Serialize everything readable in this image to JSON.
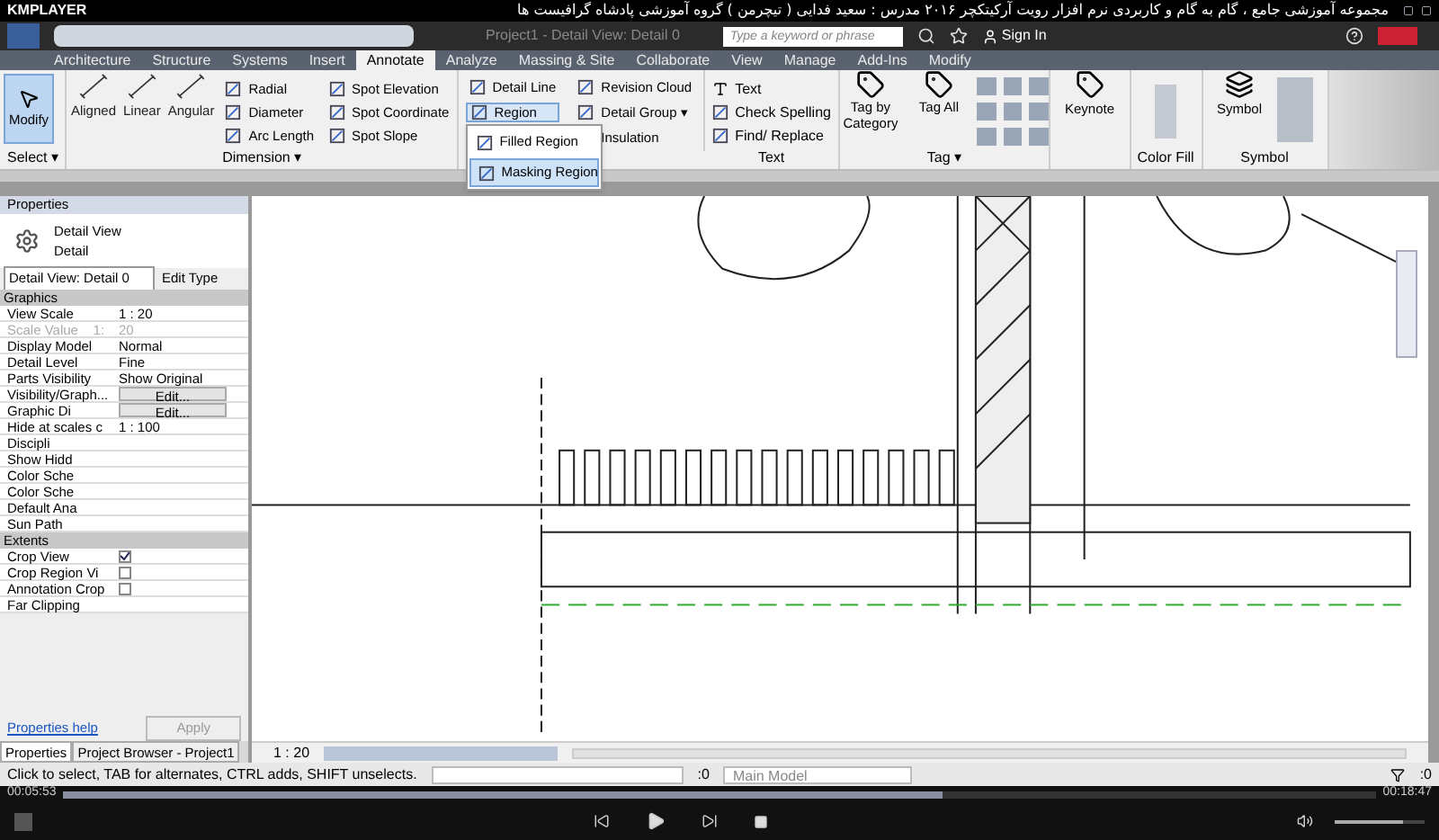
{
  "player": {
    "brand": "KMPLAYER",
    "title": "مجموعه آموزشی جامع ، گام به گام و کاربردی نرم افزار رویت آرکیتکچر ۲۰۱۶ مدرس : سعید فدایی ( تیچرمن ) گروه آموزشی پادشاه گرافیست ها",
    "elapsed": "00:05:53",
    "total": "00:18:47",
    "seek": {
      "level": 0.67
    },
    "volume": {
      "level": 0.75
    }
  },
  "app": {
    "title": "Project1 - Detail View: Detail 0",
    "search": {
      "placeholder": "Type a keyword or phrase"
    },
    "sign_in": "Sign In"
  },
  "tabs": [
    {
      "label": "Architecture",
      "selected": false
    },
    {
      "label": "Structure",
      "selected": false
    },
    {
      "label": "Systems",
      "selected": false
    },
    {
      "label": "Insert",
      "selected": false
    },
    {
      "label": "Annotate",
      "selected": true
    },
    {
      "label": "Analyze",
      "selected": false
    },
    {
      "label": "Massing & Site",
      "selected": false
    },
    {
      "label": "Collaborate",
      "selected": false
    },
    {
      "label": "View",
      "selected": false
    },
    {
      "label": "Manage",
      "selected": false
    },
    {
      "label": "Add-Ins",
      "selected": false
    },
    {
      "label": "Modify",
      "selected": false
    }
  ],
  "ribbon": {
    "select": {
      "button": "Modify",
      "footer": "Select ▾"
    },
    "dimension": {
      "big": [
        "Aligned",
        "Linear",
        "Angular"
      ],
      "small": [
        "Radial",
        "Diameter",
        "Arc Length",
        "Spot Elevation",
        "Spot Coordinate",
        "Spot Slope"
      ],
      "footer": "Dimension ▾"
    },
    "detail": {
      "items": [
        "Detail Line",
        "Region",
        "Revision Cloud",
        "Detail Group ▾",
        "Insulation"
      ]
    },
    "text": {
      "big": "Text",
      "small": [
        "Check Spelling",
        "Find/ Replace"
      ],
      "footer": "Text"
    },
    "tag": {
      "big": [
        "Tag by Category",
        "Tag All"
      ],
      "footer": "Tag ▾"
    },
    "keynote": "Keynote",
    "color_fill": {
      "footer": "Color Fill"
    },
    "symbol": {
      "big": "Symbol",
      "footer": "Symbol"
    }
  },
  "region_menu": [
    {
      "label": "Filled Region",
      "selected": false
    },
    {
      "label": "Masking Region",
      "selected": true
    }
  ],
  "properties": {
    "title": "Properties",
    "type_name": "Detail View",
    "type_sub": "Detail",
    "selector": "Detail View: Detail 0",
    "edit_type": "Edit Type",
    "sections": [
      {
        "name": "Graphics",
        "rows": [
          {
            "label": "View Scale",
            "value": "1 : 20",
            "disabled": false
          },
          {
            "label": "Scale Value    1:",
            "value": "20",
            "disabled": true
          },
          {
            "label": "Display Model",
            "value": "Normal",
            "disabled": false
          },
          {
            "label": "Detail Level",
            "value": "Fine",
            "disabled": false
          },
          {
            "label": "Parts Visibility",
            "value": "Show Original",
            "disabled": false
          },
          {
            "label": "Visibility/Graph...",
            "value": "Edit...",
            "kind": "button",
            "disabled": false
          },
          {
            "label": "Graphic Di",
            "value": "Edit...",
            "kind": "button",
            "disabled": false
          },
          {
            "label": "Hide at scales c",
            "value": "1 : 100",
            "disabled": false
          },
          {
            "label": "Discipli",
            "disabled": false
          },
          {
            "label": "Show Hidd",
            "disabled": false
          },
          {
            "label": "Color Sche",
            "disabled": false
          },
          {
            "label": "Color Sche",
            "disabled": false
          },
          {
            "label": "Default Ana",
            "disabled": false
          },
          {
            "label": "Sun Path",
            "disabled": false
          }
        ]
      },
      {
        "name": "Extents",
        "rows": [
          {
            "label": "Crop View",
            "kind": "checkbox",
            "checked": true,
            "disabled": false
          },
          {
            "label": "Crop Region Vi",
            "kind": "checkbox",
            "checked": false,
            "disabled": false
          },
          {
            "label": "Annotation Crop",
            "kind": "checkbox",
            "checked": false,
            "disabled": false
          },
          {
            "label": "Far Clipping",
            "disabled": false
          }
        ]
      }
    ],
    "help": "Properties help",
    "apply": "Apply"
  },
  "panel_tabs": [
    {
      "label": "Properties",
      "selected": true
    },
    {
      "label": "Project Browser - Project1",
      "selected": false
    }
  ],
  "view_bar": {
    "scale": "1 : 20"
  },
  "status_bar": {
    "message": "Click to select, TAB for alternates, CTRL adds, SHIFT unselects.",
    "count": ":0",
    "model": "Main Model",
    "filter_count": ":0"
  }
}
